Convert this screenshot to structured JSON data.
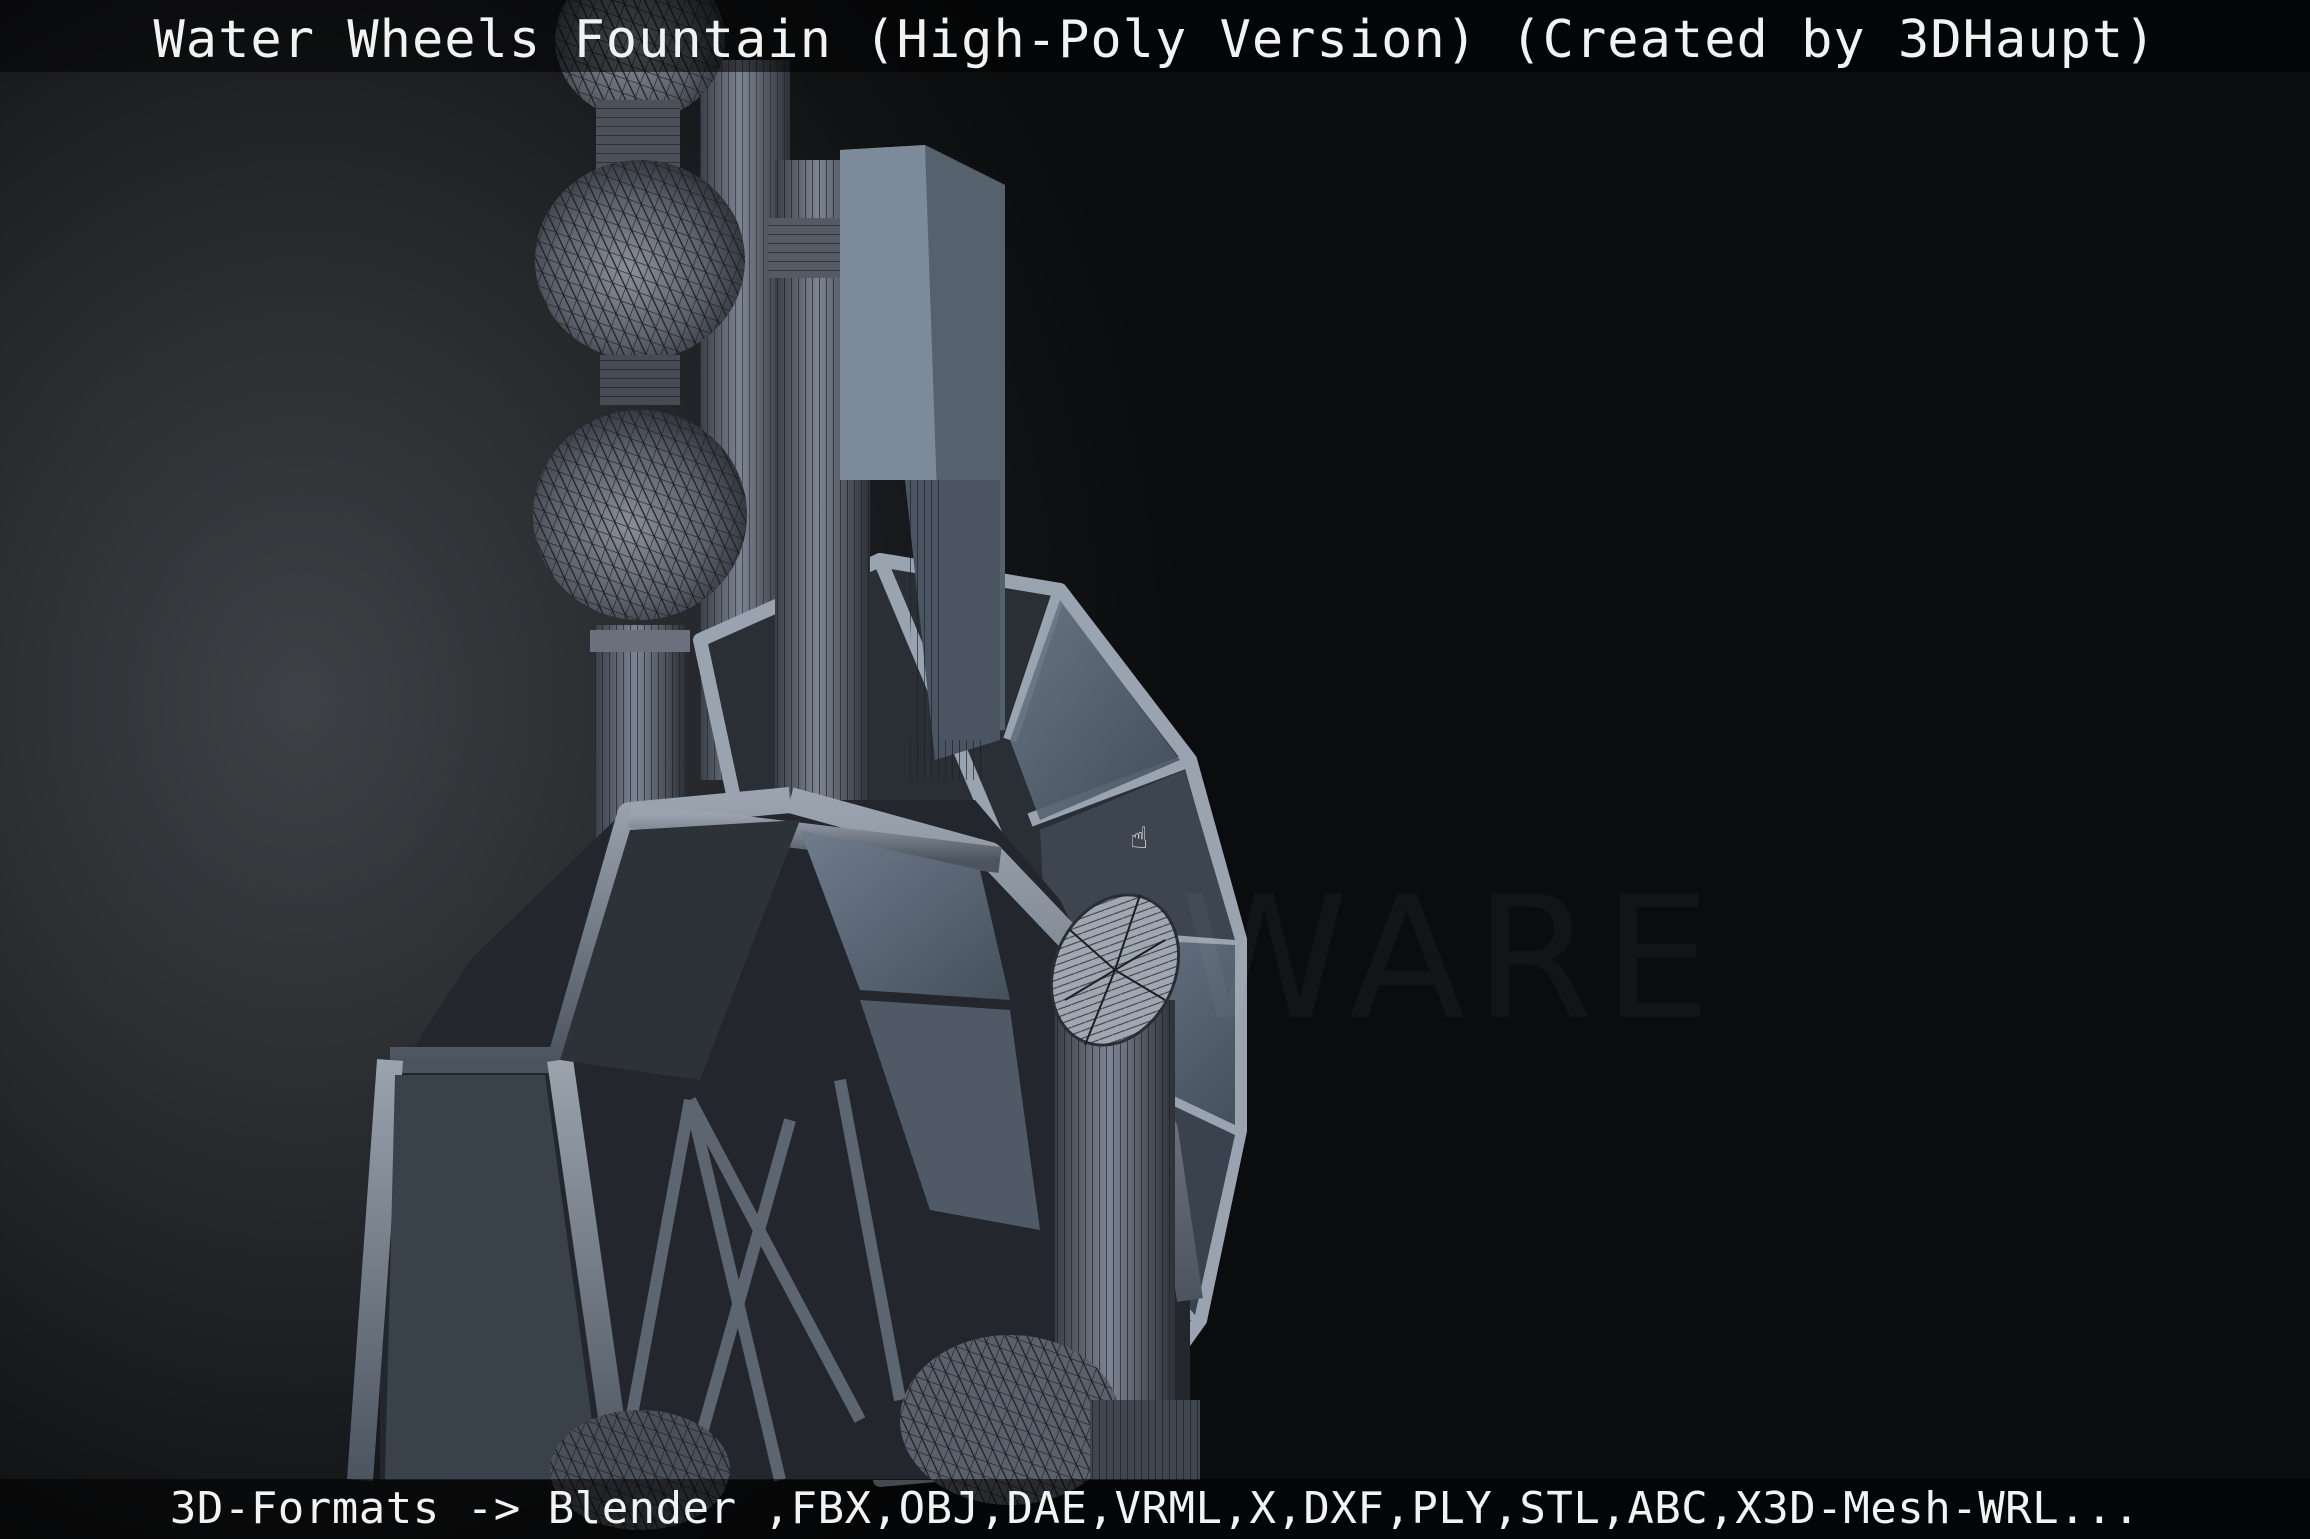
{
  "header": {
    "title": "Water Wheels Fountain (High-Poly Version) (Created by 3DHaupt)"
  },
  "footer": {
    "formats": "3D-Formats -> Blender ,FBX,OBJ,DAE,VRML,X,DXF,PLY,STL,ABC,X3D-Mesh-WRL..."
  },
  "viewport": {
    "model": "water-wheels-fountain-wireframe",
    "background_color": "#0b0c0e",
    "model_color": "#5e6b7a",
    "cursor": "hand-pointer-icon"
  }
}
